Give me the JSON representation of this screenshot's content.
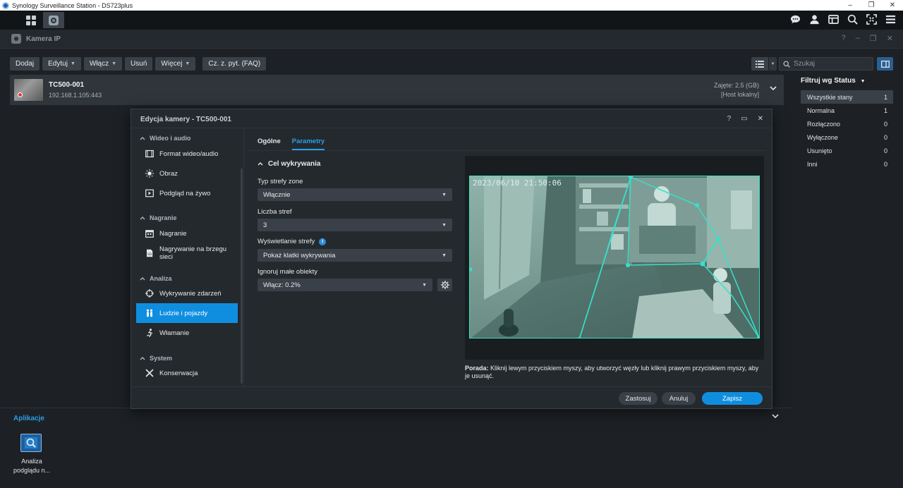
{
  "window": {
    "title": "Synology Surveillance Station - DS723plus",
    "controls": [
      "–",
      "❐",
      "✕"
    ]
  },
  "app_window": {
    "title": "Kamera IP",
    "controls": [
      "?",
      "–",
      "❐",
      "✕"
    ]
  },
  "toolbar": {
    "add": "Dodaj",
    "edit": "Edytuj",
    "enable": "Włącz",
    "delete": "Usuń",
    "more": "Więcej",
    "faq": "Cz. z. pyt. (FAQ)",
    "search_placeholder": "Szukaj"
  },
  "camera": {
    "name": "TC500-001",
    "ip": "192.168.1.105:443",
    "occupied": "Zajęte: 2.5 (GB)",
    "host": "[Host lokalny]"
  },
  "filter": {
    "title": "Filtruj wg Status",
    "items": [
      {
        "label": "Wszystkie stany",
        "count": "1"
      },
      {
        "label": "Normalna",
        "count": "1"
      },
      {
        "label": "Rozłączono",
        "count": "0"
      },
      {
        "label": "Wyłączone",
        "count": "0"
      },
      {
        "label": "Usunięto",
        "count": "0"
      },
      {
        "label": "Inni",
        "count": "0"
      }
    ]
  },
  "apps": {
    "title": "Aplikacje",
    "item_label_line1": "Analiza",
    "item_label_line2": "podglądu n..."
  },
  "dialog": {
    "title": "Edycja kamery - TC500-001",
    "controls": [
      "?",
      "▭",
      "✕"
    ],
    "sidebar": {
      "sections": {
        "video": "Wideo i audio",
        "recording": "Nagranie",
        "analysis": "Analiza",
        "system": "System"
      },
      "items": {
        "video_format": "Format wideo/audio",
        "image": "Obraz",
        "live_view": "Podgląd na żywo",
        "recording": "Nagranie",
        "edge_recording_1": "Nagrywanie na brzegu",
        "edge_recording_2": "sieci",
        "event_detection": "Wykrywanie zdarzeń",
        "people_vehicles": "Ludzie i pojazdy",
        "intrusion": "Włamanie",
        "maintenance": "Konserwacja"
      }
    },
    "tabs": {
      "general": "Ogólne",
      "params": "Parametry"
    },
    "section_title": "Cel wykrywania",
    "fields": {
      "zone_type_label": "Typ strefy zone",
      "zone_type_value": "Włącznie",
      "zone_count_label": "Liczba stref",
      "zone_count_value": "3",
      "zone_display_label": "Wyświetlanie strefy",
      "zone_display_value": "Pokaż klatki wykrywania",
      "ignore_small_label": "Ignoruj małe obiekty",
      "ignore_small_value": "Włącz: 0.2%"
    },
    "preview_timestamp": "2023/06/10 21:50:06",
    "tip_label": "Porada:",
    "tip_text": "Kliknij lewym przyciskiem myszy, aby utworzyć węzły lub kliknij prawym przyciskiem myszy, aby je usunąć.",
    "footer": {
      "apply": "Zastosuj",
      "cancel": "Anuluj",
      "save": "Zapisz"
    }
  },
  "colors": {
    "accent": "#0f8ee0",
    "zone_line": "#37e0c8",
    "background": "#1d2125"
  }
}
